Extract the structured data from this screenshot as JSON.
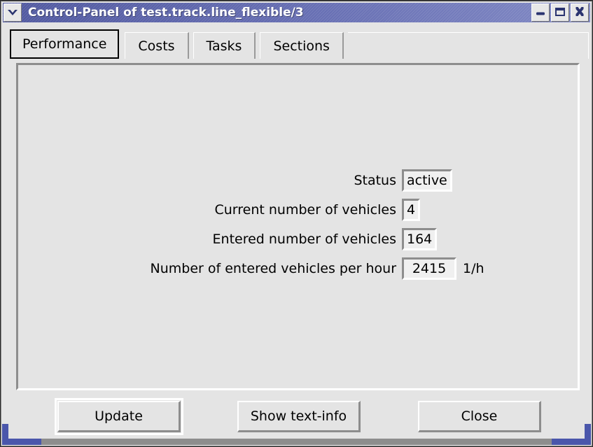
{
  "window": {
    "title": "Control-Panel of test.track.line_flexible/3",
    "menu_icon": "chevron-down-icon",
    "controls": {
      "minimize": "minimize-icon",
      "maximize": "maximize-icon",
      "close": "close-icon"
    },
    "titlebar_color": "#6870b4",
    "background_color": "#e4e4e4"
  },
  "tabs": [
    {
      "label": "Performance",
      "active": true
    },
    {
      "label": "Costs",
      "active": false
    },
    {
      "label": "Tasks",
      "active": false
    },
    {
      "label": "Sections",
      "active": false
    }
  ],
  "form": {
    "rows": [
      {
        "label": "Status",
        "value": "active",
        "unit": ""
      },
      {
        "label": "Current number of vehicles",
        "value": "4",
        "unit": ""
      },
      {
        "label": "Entered number of vehicles",
        "value": "164",
        "unit": ""
      },
      {
        "label": "Number of entered vehicles per hour",
        "value": "2415",
        "unit": "1/h"
      }
    ]
  },
  "buttons": {
    "update": "Update",
    "show_text_info": "Show text-info",
    "close": "Close"
  }
}
